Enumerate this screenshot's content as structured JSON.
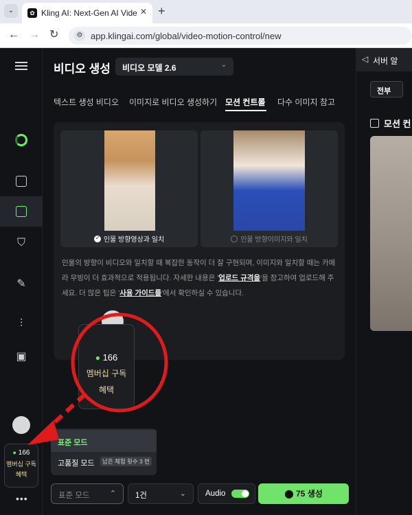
{
  "browser": {
    "tab_title": "Kling AI: Next-Gen AI Video &",
    "url": "app.klingai.com/global/video-motion-control/new"
  },
  "header": {
    "title": "비디오 생성",
    "model": "비디오 모델 2.6"
  },
  "tabs": [
    {
      "label": "텍스트 생성 비디오"
    },
    {
      "label": "이미지로 비디오 생성하기"
    },
    {
      "label": "모션 컨트롤"
    },
    {
      "label": "다수 이미지 참고"
    }
  ],
  "orientation": {
    "video_option": "인물 방향영상과 일치",
    "image_option": "인물 방향이미지와 일치"
  },
  "description": {
    "part1": "인물의 방향이 비디오와 일치할 때 복잡한 동작이 더 잘 구현되며, 이미지와 일치할 때는 카메라 무빙이 더 효과적으로 적용됩니다. 자세한 내용은 '",
    "link1": "업로드 규격을",
    "part2": "'을 참고하여 업로드해 주세요. 더 많은 팁은 '",
    "link2": "사용 가이드를",
    "part3": "'에서 확인하실 수 있습니다."
  },
  "credits": {
    "count": "166",
    "membership": "멤버십 구독",
    "benefit": "혜택"
  },
  "mode_menu": {
    "standard": "표준 모드",
    "high_quality": "고품질 모드",
    "hq_badge": "남은 체험 횟수 3 번"
  },
  "controls": {
    "mode_value": "표준 모드",
    "count_value": "1건",
    "audio_label": "Audio",
    "audio_on": true,
    "generate_cost": "75",
    "generate_label": "생성"
  },
  "right_panel": {
    "notice": "서버 알",
    "filter_all": "전부",
    "section_title": "모션 컨"
  },
  "colors": {
    "accent_green": "#6fe36a",
    "annotation_red": "#e01b1b"
  }
}
